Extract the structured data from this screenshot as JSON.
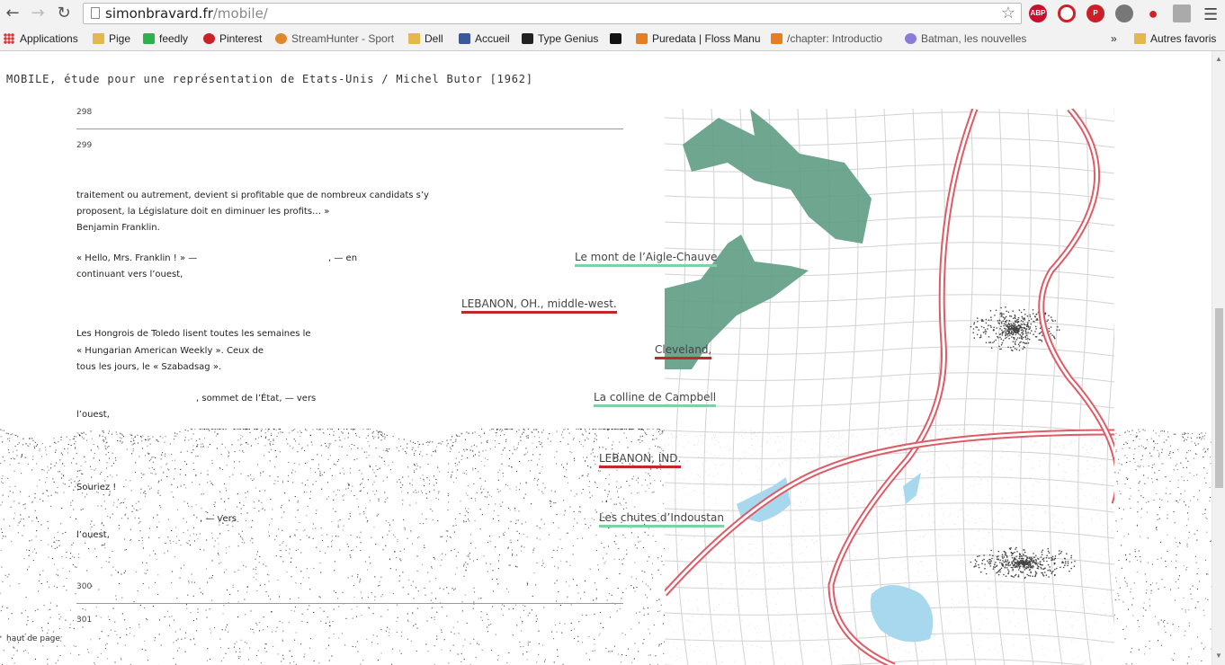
{
  "browser": {
    "url_domain": "simonbravard.fr",
    "url_path": "/mobile/",
    "back_icon": "arrow-left-icon",
    "forward_icon": "arrow-right-icon",
    "reload_icon": "reload-icon",
    "extensions": [
      {
        "name": "adblock-icon",
        "label": "ABP",
        "color": "#c8102e"
      },
      {
        "name": "opera-icon",
        "label": "",
        "color": "#d21f26"
      },
      {
        "name": "pinterest-icon",
        "label": "",
        "color": "#cb2027"
      },
      {
        "name": "ext-gray-icon",
        "label": "",
        "color": "#777777"
      },
      {
        "name": "person-icon",
        "label": "",
        "color": "#d42020"
      },
      {
        "name": "ext-puzzle-icon",
        "label": "",
        "color": "#999999"
      }
    ]
  },
  "bookmarks": {
    "items": [
      {
        "label": "Applications",
        "icon": "apps-grid-icon"
      },
      {
        "label": "Pige",
        "icon": "folder-icon"
      },
      {
        "label": "feedly",
        "icon": "feedly-icon"
      },
      {
        "label": "Pinterest",
        "icon": "pinterest-icon"
      },
      {
        "label": "StreamHunter - Sport",
        "icon": "streamhunter-icon"
      },
      {
        "label": "Dell",
        "icon": "folder-icon"
      },
      {
        "label": "Accueil",
        "icon": "facebook-icon"
      },
      {
        "label": "Type Genius",
        "icon": "typegenius-icon"
      },
      {
        "label": "",
        "icon": "t-icon"
      },
      {
        "label": "Puredata | Floss Manu",
        "icon": "floss-icon"
      },
      {
        "label": "/chapter: Introductio",
        "icon": "floss-icon"
      },
      {
        "label": "Batman, les nouvelles",
        "icon": "batman-icon"
      },
      {
        "label": "»",
        "icon": ""
      },
      {
        "label": "Autres favoris",
        "icon": "folder-icon"
      }
    ]
  },
  "page": {
    "title": "MOBILE, étude pour une représentation de Etats-Unis / Michel Butor [1962]",
    "page_numbers": [
      "298",
      "299",
      "300",
      "301"
    ],
    "lines": [
      "traitement ou autrement, devient si profitable que de nombreux candidats s’y",
      "proposent, la Législature doit en diminuer les profits… »",
      "Benjamin Franklin.",
      "« Hello, Mrs. Franklin ! » —",
      ", — en",
      "continuant vers l’ouest,",
      "Les Hongrois de Toledo lisent toutes les semaines le",
      " « Hungarian American Weekly ». Ceux de",
      " tous les jours, le « Szabadsag ».",
      ", sommet de l’État, — vers",
      "l’ouest,",
      "Souriez !",
      ", — vers",
      "l’ouest,"
    ],
    "places": [
      {
        "label": "Le mont de l’Aigle-Chauve",
        "color": "green"
      },
      {
        "label": "LEBANON, OH., middle-west.",
        "color": "red"
      },
      {
        "label": "Cleveland,",
        "color": "red"
      },
      {
        "label": "La colline de Campbell",
        "color": "green"
      },
      {
        "label": "LEBANON, IND.",
        "color": "red"
      },
      {
        "label": "Les chutes d’Indoustan",
        "color": "green"
      }
    ],
    "back_to_top": "haut de page"
  },
  "colors": {
    "road_red": "#e05a66",
    "forest_green": "#5e9c84",
    "water_blue": "#a8d8ee",
    "underline_green": "#7fd1a3",
    "underline_red": "#c1272d"
  }
}
